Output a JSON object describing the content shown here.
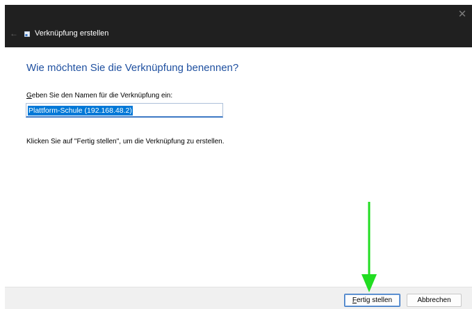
{
  "window": {
    "title": "Verknüpfung erstellen",
    "close_glyph": "✕",
    "back_glyph": "←"
  },
  "page": {
    "heading": "Wie möchten Sie die Verknüpfung benennen?",
    "field_label_accesskey": "G",
    "field_label_rest": "eben Sie den Namen für die Verknüpfung ein:",
    "name_value": "Plattform-Schule (192.168.48.2)",
    "instruction": "Klicken Sie auf \"Fertig stellen\", um die Verknüpfung zu erstellen."
  },
  "footer": {
    "finish_accesskey": "F",
    "finish_rest": "ertig stellen",
    "cancel_label": "Abbrechen"
  },
  "colors": {
    "titlebar": "#202020",
    "heading": "#1f50a0",
    "selection": "#0078d7",
    "annotation_arrow": "#22dd22"
  },
  "icons": {
    "back": "back-arrow-icon",
    "title": "shortcut-icon",
    "close": "close-icon",
    "annotation": "green-arrow-annotation"
  }
}
